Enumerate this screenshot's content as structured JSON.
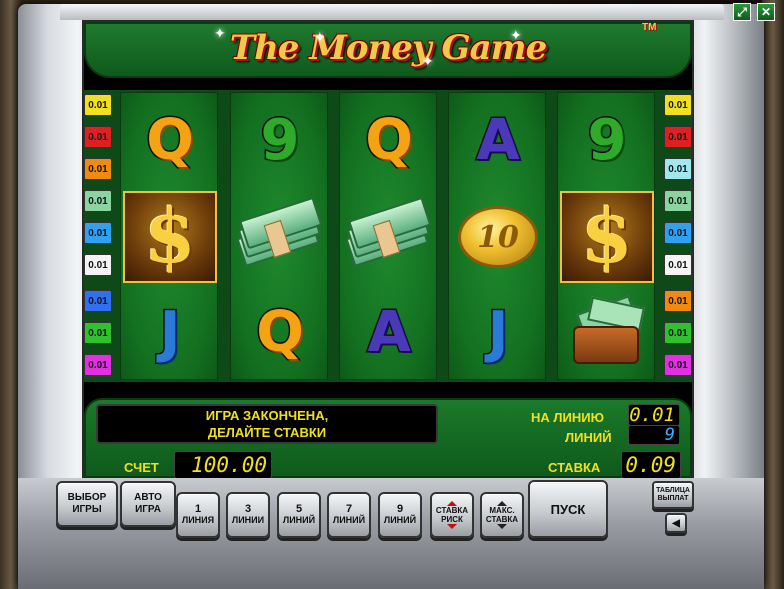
{
  "game": {
    "title": "The Money Game",
    "tm": "TM"
  },
  "window": {
    "fullscreen_icon": "expand-arrows-icon",
    "close_icon": "close-icon"
  },
  "reels": [
    [
      "Q",
      "$",
      "J"
    ],
    [
      "9",
      "cash",
      "Q"
    ],
    [
      "Q",
      "cash",
      "A"
    ],
    [
      "A",
      "10",
      "J"
    ],
    [
      "9",
      "$",
      "wallet"
    ]
  ],
  "coin_value": "10",
  "line_labels_left": [
    "0.01",
    "0.01",
    "0.01",
    "0.01",
    "0.01",
    "0.01",
    "0.01",
    "0.01",
    "0.01"
  ],
  "line_labels_right": [
    "0.01",
    "0.01",
    "0.01",
    "0.01",
    "0.01",
    "0.01",
    "0.01",
    "0.01",
    "0.01"
  ],
  "line_colors_left": [
    "#f0e020",
    "#e02020",
    "#f08a10",
    "#8ad4a0",
    "#30a0f0",
    "#f4f4f4",
    "#3070f0",
    "#30c030",
    "#e030e0"
  ],
  "line_colors_right": [
    "#f0e020",
    "#e02020",
    "#a0e8f0",
    "#8ad4a0",
    "#30a0f0",
    "#f4f4f4",
    "#f08a10",
    "#30c030",
    "#e030e0"
  ],
  "status": {
    "message_line1": "ИГРА ЗАКОНЧЕНА,",
    "message_line2": "ДЕЛАЙТЕ СТАВКИ"
  },
  "bet": {
    "per_line_label": "НА ЛИНИЮ",
    "per_line_value": "0.01",
    "lines_label": "ЛИНИЙ",
    "lines_value": "9",
    "total_label": "СТАВКА",
    "total_value": "0.09"
  },
  "balance": {
    "label": "СЧЕТ",
    "value": "100.00"
  },
  "buttons": {
    "select_game_1": "ВЫБОР",
    "select_game_2": "ИГРЫ",
    "auto_1": "АВТО",
    "auto_2": "ИГРА",
    "line1_num": "1",
    "line1_label": "ЛИНИЯ",
    "line3_num": "3",
    "line3_label": "ЛИНИИ",
    "line5_num": "5",
    "line5_label": "ЛИНИЙ",
    "line7_num": "7",
    "line7_label": "ЛИНИЙ",
    "line9_num": "9",
    "line9_label": "ЛИНИЙ",
    "risk_1": "СТАВКА",
    "risk_2": "РИСК",
    "max_1": "МАКС.",
    "max_2": "СТАВКА",
    "spin": "ПУСК",
    "paytable_1": "ТАБЛИЦА",
    "paytable_2": "ВЫПЛАТ",
    "sound_icon": "speaker-icon"
  }
}
